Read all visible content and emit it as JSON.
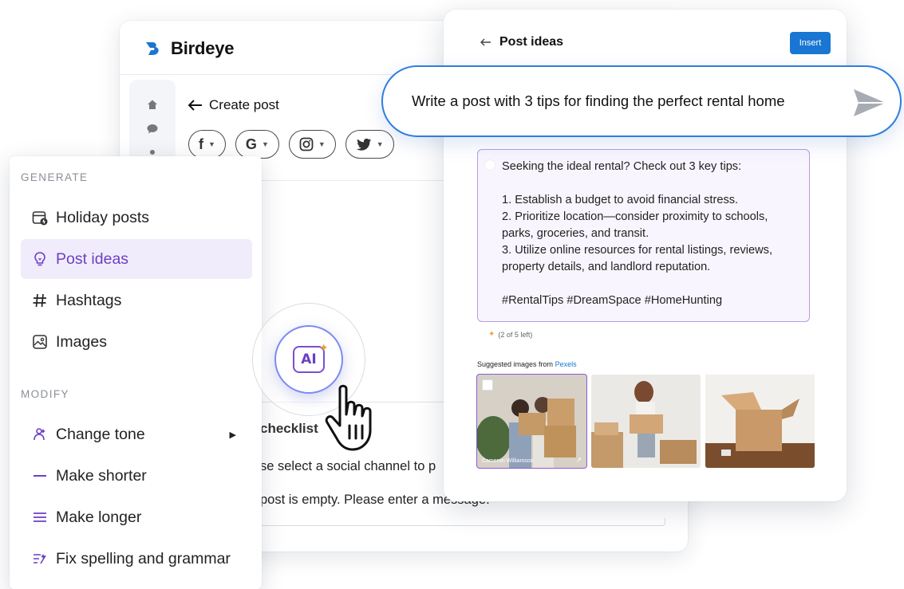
{
  "app": {
    "brand": "Birdeye",
    "create_post_label": "Create post",
    "channels": [
      {
        "icon": "facebook-icon",
        "glyph": "f"
      },
      {
        "icon": "google-icon",
        "glyph": "G"
      },
      {
        "icon": "instagram-icon",
        "glyph": "◎"
      },
      {
        "icon": "twitter-icon",
        "glyph": "🐦"
      }
    ],
    "checklist": {
      "title": "checklist",
      "items": [
        "se select a social channel to p",
        "post is empty. Please enter a message."
      ]
    }
  },
  "ideas_panel": {
    "title": "Post ideas",
    "insert_label": "Insert",
    "result": {
      "intro": "Seeking the ideal rental? Check out 3 key tips:",
      "tips": [
        "1. Establish a budget to avoid financial stress.",
        "2. Prioritize location—consider proximity to schools, parks, groceries, and transit.",
        "3. Utilize online resources for rental listings, reviews, property details, and landlord reputation."
      ],
      "hashtags": "#RentalTips #DreamSpace #HomeHunting"
    },
    "uses_left": "(2 of 5 left)",
    "suggested_prefix": "Suggested images from ",
    "suggested_source": "Pexels",
    "images": [
      {
        "credit": "Cameron Williamson",
        "selected": true
      },
      {
        "credit": "",
        "selected": false
      },
      {
        "credit": "",
        "selected": false
      }
    ]
  },
  "prompt": {
    "text": "Write a post with 3 tips for finding the perfect rental home"
  },
  "ai_menu": {
    "generate_label": "GENERATE",
    "modify_label": "MODIFY",
    "generate_items": [
      {
        "label": "Holiday posts",
        "icon": "calendar-icon"
      },
      {
        "label": "Post ideas",
        "icon": "lightbulb-icon",
        "active": true
      },
      {
        "label": "Hashtags",
        "icon": "hashtag-icon"
      },
      {
        "label": "Images",
        "icon": "image-icon"
      }
    ],
    "modify_items": [
      {
        "label": "Change tone",
        "icon": "tone-icon",
        "has_submenu": true
      },
      {
        "label": "Make shorter",
        "icon": "shorter-icon"
      },
      {
        "label": "Make longer",
        "icon": "longer-icon"
      },
      {
        "label": "Fix spelling and grammar",
        "icon": "spellcheck-icon"
      }
    ]
  },
  "ai_button": {
    "label": "AI"
  },
  "colors": {
    "accent_purple": "#6b3fc6",
    "active_bg": "#f1ecfb",
    "insert_blue": "#1976d2",
    "bubble_border": "#2d7fe0"
  }
}
